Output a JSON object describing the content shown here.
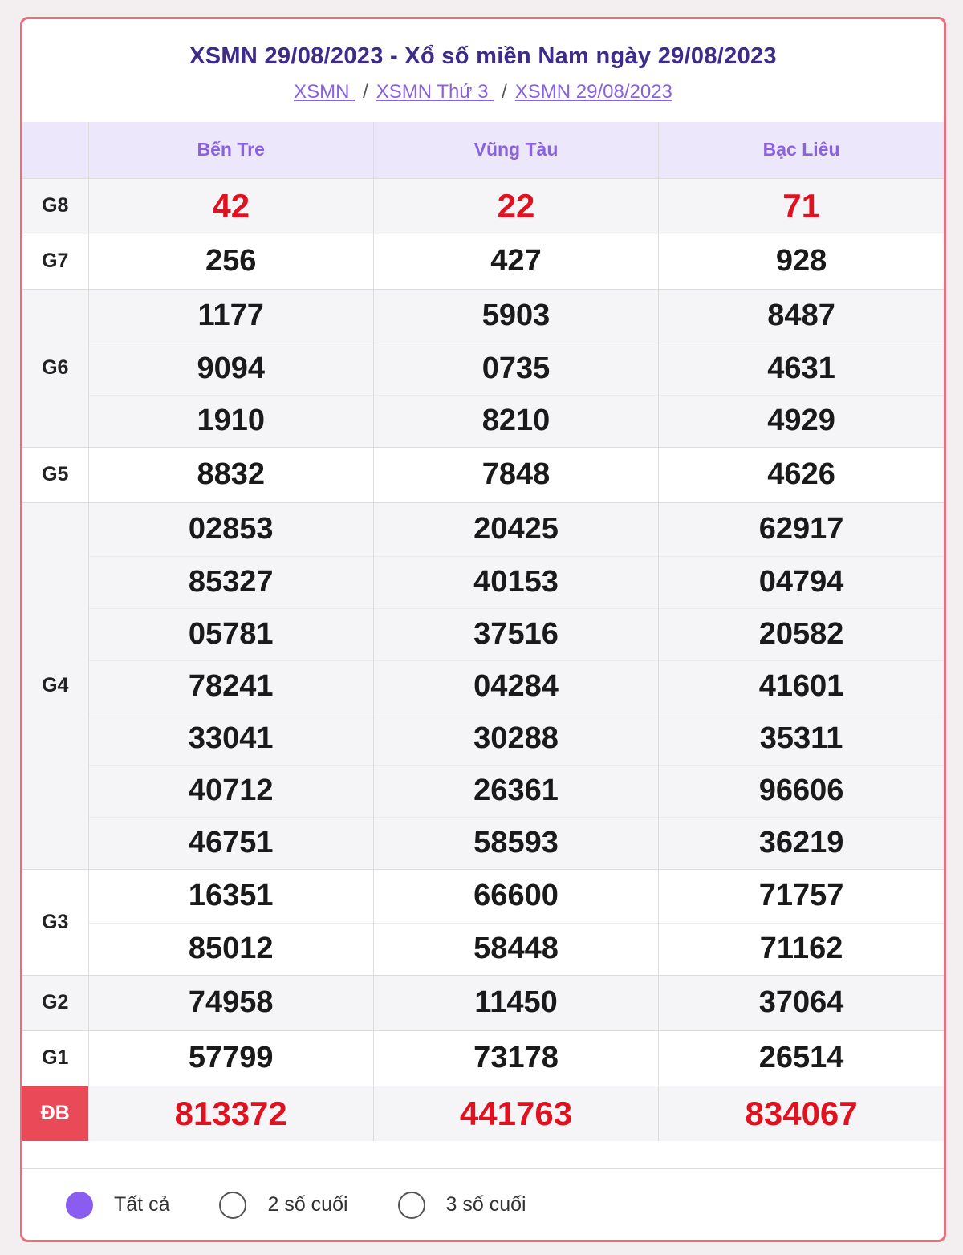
{
  "header": {
    "title": "XSMN 29/08/2023 - Xổ số miền Nam ngày 29/08/2023",
    "breadcrumb": [
      "XSMN ",
      "XSMN Thứ 3 ",
      "XSMN 29/08/2023"
    ],
    "separator": "/"
  },
  "table": {
    "columns": [
      "Bến Tre",
      "Vũng Tàu",
      "Bạc Liêu"
    ],
    "prizes": [
      {
        "label": "G8",
        "rows": [
          [
            "42",
            "22",
            "71"
          ]
        ]
      },
      {
        "label": "G7",
        "rows": [
          [
            "256",
            "427",
            "928"
          ]
        ]
      },
      {
        "label": "G6",
        "rows": [
          [
            "1177",
            "5903",
            "8487"
          ],
          [
            "9094",
            "0735",
            "4631"
          ],
          [
            "1910",
            "8210",
            "4929"
          ]
        ]
      },
      {
        "label": "G5",
        "rows": [
          [
            "8832",
            "7848",
            "4626"
          ]
        ]
      },
      {
        "label": "G4",
        "rows": [
          [
            "02853",
            "20425",
            "62917"
          ],
          [
            "85327",
            "40153",
            "04794"
          ],
          [
            "05781",
            "37516",
            "20582"
          ],
          [
            "78241",
            "04284",
            "41601"
          ],
          [
            "33041",
            "30288",
            "35311"
          ],
          [
            "40712",
            "26361",
            "96606"
          ],
          [
            "46751",
            "58593",
            "36219"
          ]
        ]
      },
      {
        "label": "G3",
        "rows": [
          [
            "16351",
            "66600",
            "71757"
          ],
          [
            "85012",
            "58448",
            "71162"
          ]
        ]
      },
      {
        "label": "G2",
        "rows": [
          [
            "74958",
            "11450",
            "37064"
          ]
        ]
      },
      {
        "label": "G1",
        "rows": [
          [
            "57799",
            "73178",
            "26514"
          ]
        ]
      },
      {
        "label": "ĐB",
        "rows": [
          [
            "813372",
            "441763",
            "834067"
          ]
        ]
      }
    ]
  },
  "filters": {
    "options": [
      "Tất cả",
      "2 số cuối",
      "3 số cuối"
    ],
    "selected": "Tất cả"
  },
  "colors": {
    "title": "#3e2c8c",
    "accent": "#8a62de",
    "highlight_red": "#e0121f",
    "border": "#e8707c",
    "db_badge": "#ea4a57"
  }
}
